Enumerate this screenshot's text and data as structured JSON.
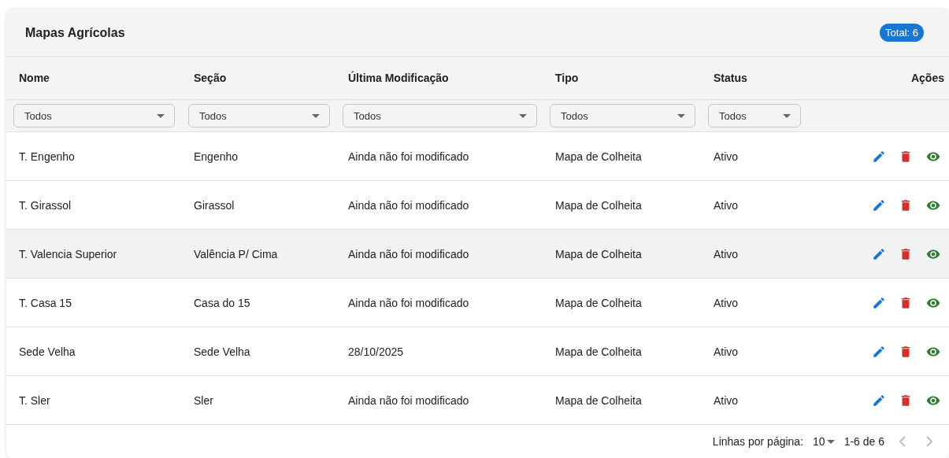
{
  "title": "Mapas Agrícolas",
  "total_badge": "Total: 6",
  "columns": [
    "Nome",
    "Seção",
    "Última Modificação",
    "Tipo",
    "Status",
    "Ações"
  ],
  "filters": [
    {
      "value": "Todos"
    },
    {
      "value": "Todos"
    },
    {
      "value": "Todos"
    },
    {
      "value": "Todos"
    },
    {
      "value": "Todos"
    }
  ],
  "rows": [
    {
      "cells": [
        "T. Engenho",
        "Engenho",
        "Ainda não foi modificado",
        "Mapa de Colheita",
        "Ativo"
      ],
      "highlighted": false
    },
    {
      "cells": [
        "T. Girassol",
        "Girassol",
        "Ainda não foi modificado",
        "Mapa de Colheita",
        "Ativo"
      ],
      "highlighted": false
    },
    {
      "cells": [
        "T. Valencia Superior",
        "Valência P/ Cima",
        "Ainda não foi modificado",
        "Mapa de Colheita",
        "Ativo"
      ],
      "highlighted": true
    },
    {
      "cells": [
        "T. Casa 15",
        "Casa do 15",
        "Ainda não foi modificado",
        "Mapa de Colheita",
        "Ativo"
      ],
      "highlighted": false
    },
    {
      "cells": [
        "Sede Velha",
        "Sede Velha",
        "28/10/2025",
        "Mapa de Colheita",
        "Ativo"
      ],
      "highlighted": false
    },
    {
      "cells": [
        "T. Sler",
        "Sler",
        "Ainda não foi modificado",
        "Mapa de Colheita",
        "Ativo"
      ],
      "highlighted": false
    }
  ],
  "pagination": {
    "rows_per_page_label": "Linhas por página:",
    "rows_per_page": "10",
    "range": "1-6 de 6",
    "prev_disabled": true,
    "next_disabled": true
  }
}
